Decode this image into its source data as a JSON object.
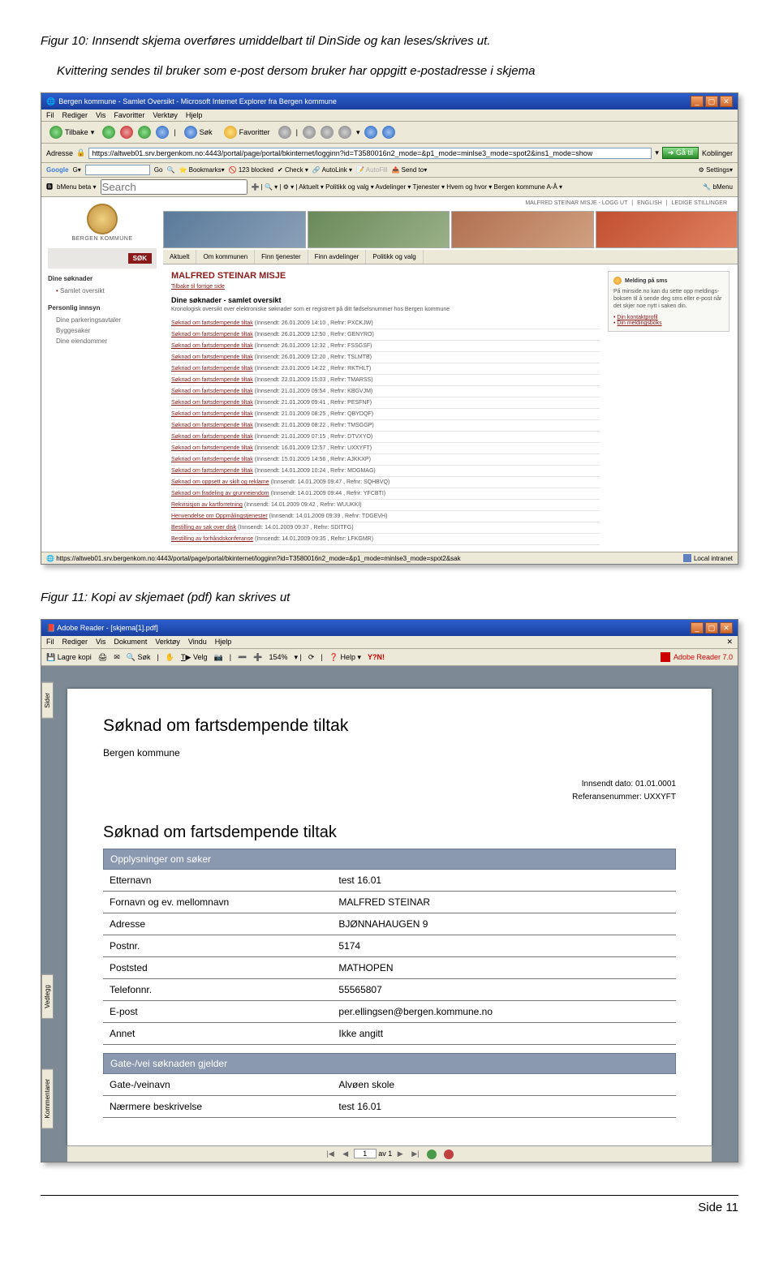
{
  "captions": {
    "fig10_line1": "Figur 10: Innsendt skjema overføres umiddelbart til DinSide og kan leses/skrives ut.",
    "fig10_line2": "Kvittering sendes til bruker som e-post dersom bruker har oppgitt e-postadresse i skjema",
    "fig11": "Figur 11: Kopi av skjemaet (pdf) kan skrives ut"
  },
  "ie": {
    "title": "Bergen kommune - Samlet Oversikt - Microsoft Internet Explorer fra Bergen kommune",
    "menu": [
      "Fil",
      "Rediger",
      "Vis",
      "Favoritter",
      "Verktøy",
      "Hjelp"
    ],
    "toolbar": {
      "back": "Tilbake",
      "search": "Søk",
      "fav": "Favoritter"
    },
    "address_label": "Adresse",
    "address_url": "https://altweb01.srv.bergenkom.no:4443/portal/page/portal/bkinternet/logginn?id=T3580016n2_mode=&p1_mode=minlse3_mode=spot2&ins1_mode=show",
    "go": "Gå til",
    "links": "Koblinger",
    "google": {
      "label": "Google",
      "go": "Go",
      "bookmarks": "Bookmarks▾",
      "blocked": "123 blocked",
      "check": "Check ▾",
      "autolink": "AutoLink ▾",
      "autofill": "AutoFill",
      "send": "Send to▾",
      "settings": "Settings▾"
    },
    "bmenu": {
      "label": "bMenu beta ▾",
      "search_ph": "Search",
      "items": "Aktuelt ▾  Politikk og valg ▾  Avdelinger ▾  Tjenester ▾  Hvem og hvor ▾  Bergen kommune A-Å ▾",
      "right": "bMenu"
    },
    "statusbar_url": "https://altweb01.srv.bergenkom.no:4443/portal/page/portal/bkinternet/logginn?id=T3580016n2_mode=&p1_mode=minlse3_mode=spot2&sak",
    "statusbar_zone": "Local intranet"
  },
  "portal": {
    "org": "BERGEN KOMMUNE",
    "search_btn": "SØK",
    "nav": {
      "dine": "Dine søknader",
      "samlet": "Samlet oversikt",
      "personlig": "Personlig innsyn",
      "items": [
        "Dine parkeringsavtaler",
        "Byggesaker",
        "Dine eiendommer"
      ]
    },
    "toplinks": [
      "MALFRED STEINAR MISJE - LOGG UT",
      "ENGLISH",
      "LEDIGE STILLINGER"
    ],
    "tabs": [
      "Aktuelt",
      "Om kommunen",
      "Finn tjenester",
      "Finn avdelinger",
      "Politikk og valg"
    ],
    "user": "MALFRED STEINAR MISJE",
    "backlink": "Tilbake til forrige side",
    "list_title": "Dine søknader - samlet oversikt",
    "list_sub": "Kronologisk oversikt over elektroniske søknader som er registrert på ditt fødselsnummer hos Bergen kommune",
    "apps": [
      {
        "t": "Søknad om fartsdempende tiltak",
        "m": "(Innsendt: 26.01.2009 14:10 , Refnr: PXCKJW)"
      },
      {
        "t": "Søknad om fartsdempende tiltak",
        "m": "(Innsendt: 26.01.2009 12:50 , Refnr: GENYRO)"
      },
      {
        "t": "Søknad om fartsdempende tiltak",
        "m": "(Innsendt: 26.01.2009 12:32 , Refnr: FSSGSF)"
      },
      {
        "t": "Søknad om fartsdempende tiltak",
        "m": "(Innsendt: 26.01.2009 12:20 , Refnr: TSLMTB)"
      },
      {
        "t": "Søknad om fartsdempende tiltak",
        "m": "(Innsendt: 23.01.2009 14:22 , Refnr: RKTHLT)"
      },
      {
        "t": "Søknad om fartsdempende tiltak",
        "m": "(Innsendt: 22.01.2009 15:03 , Refnr: TMARSS)"
      },
      {
        "t": "Søknad om fartsdempende tiltak",
        "m": "(Innsendt: 21.01.2009 09:54 , Refnr: KBGVJM)"
      },
      {
        "t": "Søknad om fartsdempende tiltak",
        "m": "(Innsendt: 21.01.2009 09:41 , Refnr: PESFNF)"
      },
      {
        "t": "Søknad om fartsdempende tiltak",
        "m": "(Innsendt: 21.01.2009 08:25 , Refnr: QBYDQF)"
      },
      {
        "t": "Søknad om fartsdempende tiltak",
        "m": "(Innsendt: 21.01.2009 08:22 , Refnr: TMSGGP)"
      },
      {
        "t": "Søknad om fartsdempende tiltak",
        "m": "(Innsendt: 21.01.2009 07:15 , Refnr: DTVXYO)"
      },
      {
        "t": "Søknad om fartsdempende tiltak",
        "m": "(Innsendt: 16.01.2009 12:57 , Refnr: UXXYFT)"
      },
      {
        "t": "Søknad om fartsdempende tiltak",
        "m": "(Innsendt: 15.01.2009 14:56 , Refnr: AJKKXP)"
      },
      {
        "t": "Søknad om fartsdempende tiltak",
        "m": "(Innsendt: 14.01.2009 10:24 , Refnr: MDGMAG)"
      },
      {
        "t": "Søknad om oppsett av skilt og reklame",
        "m": "(Innsendt: 14.01.2009 09:47 , Refnr: SQHBVQ)"
      },
      {
        "t": "Søknad om fradeling av grunneiendom",
        "m": "(Innsendt: 14.01.2009 09:44 , Refnr: YFCBTI)"
      },
      {
        "t": "Rekvisisjon av kartforretning",
        "m": "(Innsendt: 14.01.2009 09:42 , Refnr: WUUKKI)"
      },
      {
        "t": "Henvendelse om Oppmålingstjenester",
        "m": "(Innsendt: 14.01.2009 09:39 , Refnr: TDGEVH)"
      },
      {
        "t": "Bestilling av sak over disk",
        "m": "(Innsendt: 14.01.2009 09:37 , Refnr: SDITFG)"
      },
      {
        "t": "Bestilling av forhåndskonferanse",
        "m": "(Innsendt: 14.01.2009 09:35 , Refnr: LFKGMR)"
      }
    ],
    "sms": {
      "title": "Melding på sms",
      "body": "På minside.no kan du sette opp meldings- boksen til å sende deg sms eller e-post når det skjer noe nytt i saken din.",
      "links": [
        "Din kontaktprofil",
        "Din meldingsboks"
      ]
    }
  },
  "pdf": {
    "title": "Adobe Reader - [skjema[1].pdf]",
    "menu": [
      "Fil",
      "Rediger",
      "Vis",
      "Dokument",
      "Verktøy",
      "Vindu",
      "Hjelp"
    ],
    "toolbar": {
      "save": "Lagre kopi",
      "print": "Søk",
      "select": "Velg",
      "zoom": "154%",
      "help": "Help ▾",
      "yn": "Y?N!"
    },
    "adobe": "Adobe Reader 7.0",
    "side_tabs": [
      "Sider",
      "Vedlegg",
      "Kommentarer"
    ],
    "doc": {
      "h1": "Søknad om fartsdempende tiltak",
      "org": "Bergen kommune",
      "date_label": "Innsendt dato: 01.01.0001",
      "ref_label": "Referansenummer: UXXYFT",
      "h2": "Søknad om fartsdempende tiltak",
      "sec1": "Opplysninger om søker",
      "rows1": [
        [
          "Etternavn",
          "test 16.01"
        ],
        [
          "Fornavn og ev. mellomnavn",
          "MALFRED STEINAR"
        ],
        [
          "Adresse",
          "BJØNNAHAUGEN 9"
        ],
        [
          "Postnr.",
          "5174"
        ],
        [
          "Poststed",
          "MATHOPEN"
        ],
        [
          "Telefonnr.",
          "55565807"
        ],
        [
          "E-post",
          "per.ellingsen@bergen.kommune.no"
        ],
        [
          "Annet",
          "Ikke angitt"
        ]
      ],
      "sec2": "Gate-/vei søknaden gjelder",
      "rows2": [
        [
          "Gate-/veinavn",
          "Alvøen skole"
        ],
        [
          "Nærmere beskrivelse",
          "test 16.01"
        ]
      ]
    },
    "nav": {
      "page": "1",
      "of": "av 1"
    }
  },
  "footer": "Side 11"
}
